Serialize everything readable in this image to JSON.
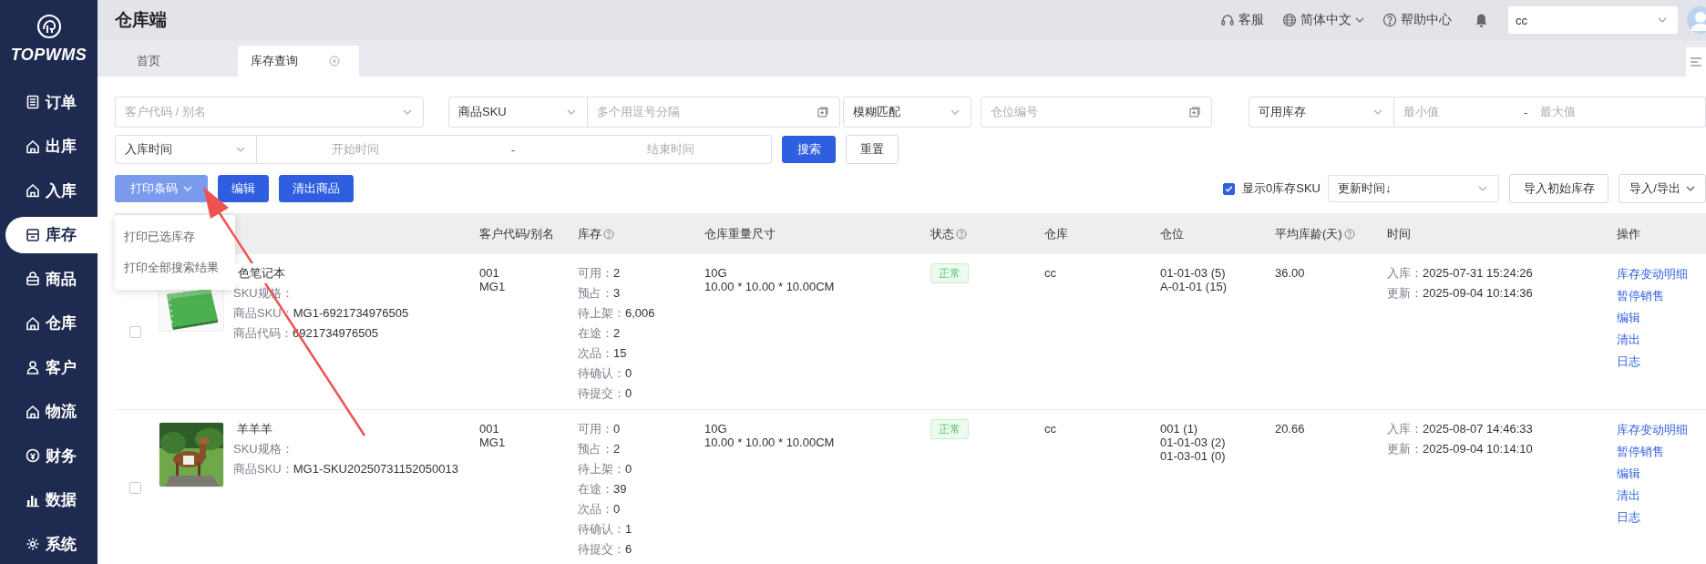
{
  "sidebar": {
    "logo": "TOPWMS",
    "items": [
      {
        "label": "订单",
        "selected": false
      },
      {
        "label": "出库",
        "selected": false
      },
      {
        "label": "入库",
        "selected": false
      },
      {
        "label": "库存",
        "selected": true
      },
      {
        "label": "商品",
        "selected": false
      },
      {
        "label": "仓库",
        "selected": false
      },
      {
        "label": "客户",
        "selected": false
      },
      {
        "label": "物流",
        "selected": false
      },
      {
        "label": "财务",
        "selected": false
      },
      {
        "label": "数据",
        "selected": false
      },
      {
        "label": "系统",
        "selected": false
      }
    ]
  },
  "header": {
    "title": "仓库端",
    "service": "客服",
    "language": "简体中文",
    "help": "帮助中心",
    "account_select": "cc"
  },
  "tabs": [
    {
      "label": "首页",
      "selected": false,
      "closable": false
    },
    {
      "label": "库存查询",
      "selected": true,
      "closable": true
    }
  ],
  "filters": {
    "customer": {
      "placeholder": "客户代码 / 别名"
    },
    "sku_type": "商品SKU",
    "sku_input": {
      "placeholder": "多个用逗号分隔"
    },
    "match_mode": "模糊匹配",
    "location": {
      "placeholder": "仓位编号"
    },
    "stock_type": "可用库存",
    "stock_range": {
      "min_placeholder": "最小值",
      "separator": "-",
      "max_placeholder": "最大值"
    },
    "date_type": "入库时间",
    "date_range": {
      "start_placeholder": "开始时间",
      "separator": "-",
      "end_placeholder": "结束时间"
    },
    "search_button": "搜索",
    "reset_button": "重置"
  },
  "actions": {
    "buttons": [
      {
        "label": "打印条码",
        "kind": "dropdown",
        "expanded": true
      },
      {
        "label": "编辑",
        "kind": "plain"
      },
      {
        "label": "清出商品",
        "kind": "plain"
      }
    ],
    "menu": [
      "打印已选库存",
      "打印全部搜索结果"
    ],
    "show_zero": {
      "label": "显示0库存SKU",
      "checked": true
    },
    "sort": "更新时间↓",
    "import_button": "导入初始库存",
    "import_export": "导入/导出"
  },
  "table": {
    "columns": [
      {
        "label": "客户代码/别名",
        "help": false
      },
      {
        "label": "库存",
        "help": true
      },
      {
        "label": "仓库重量尺寸",
        "help": false
      },
      {
        "label": "状态",
        "help": true
      },
      {
        "label": "仓库",
        "help": false
      },
      {
        "label": "仓位",
        "help": false
      },
      {
        "label": "平均库龄(天)",
        "help": true
      },
      {
        "label": "时间",
        "help": false
      },
      {
        "label": "操作",
        "help": false
      }
    ],
    "rows": [
      {
        "selected": false,
        "name": "色笔记本",
        "info": [
          {
            "label": "SKU规格："
          },
          {
            "label": "商品SKU：",
            "value": "MG1-6921734976505"
          },
          {
            "label": "商品代码：",
            "value": "6921734976505"
          }
        ],
        "customer": [
          "001",
          "MG1"
        ],
        "stock": [
          {
            "label": "可用：",
            "value": "2"
          },
          {
            "label": "预占：",
            "value": "3"
          },
          {
            "label": "待上架：",
            "value": "6,006"
          },
          {
            "label": "在途：",
            "value": "2"
          },
          {
            "label": "次品：",
            "value": "15"
          },
          {
            "label": "待确认：",
            "value": "0"
          },
          {
            "label": "待提交：",
            "value": "0"
          }
        ],
        "size": [
          "10G",
          "10.00 * 10.00 * 10.00CM"
        ],
        "status": "正常",
        "warehouse": "cc",
        "locations": [
          "01-01-03 (5)",
          "A-01-01 (15)"
        ],
        "age": "36.00",
        "times": [
          {
            "label": "入库：",
            "value": "2025-07-31 15:24:26"
          },
          {
            "label": "更新：",
            "value": "2025-09-04 10:14:36"
          }
        ],
        "links": [
          "库存变动明细",
          "暂停销售",
          "编辑",
          "清出",
          "日志"
        ]
      },
      {
        "selected": false,
        "name": "羊羊羊",
        "info": [
          {
            "label": "SKU规格："
          },
          {
            "label": "商品SKU：",
            "value": "MG1-SKU20250731152050013"
          }
        ],
        "customer": [
          "001",
          "MG1"
        ],
        "stock": [
          {
            "label": "可用：",
            "value": "0"
          },
          {
            "label": "预占：",
            "value": "2"
          },
          {
            "label": "待上架：",
            "value": "0"
          },
          {
            "label": "在途：",
            "value": "39"
          },
          {
            "label": "次品：",
            "value": "0"
          },
          {
            "label": "待确认：",
            "value": "1"
          },
          {
            "label": "待提交：",
            "value": "6"
          }
        ],
        "size": [
          "10G",
          "10.00 * 10.00 * 10.00CM"
        ],
        "status": "正常",
        "warehouse": "cc",
        "locations": [
          "001 (1)",
          "01-01-03 (2)",
          "01-03-01 (0)"
        ],
        "age": "20.66",
        "times": [
          {
            "label": "入库：",
            "value": "2025-08-07 14:46:33"
          },
          {
            "label": "更新：",
            "value": "2025-09-04 10:14:10"
          }
        ],
        "links": [
          "库存变动明细",
          "暂停销售",
          "编辑",
          "清出",
          "日志"
        ]
      }
    ]
  }
}
